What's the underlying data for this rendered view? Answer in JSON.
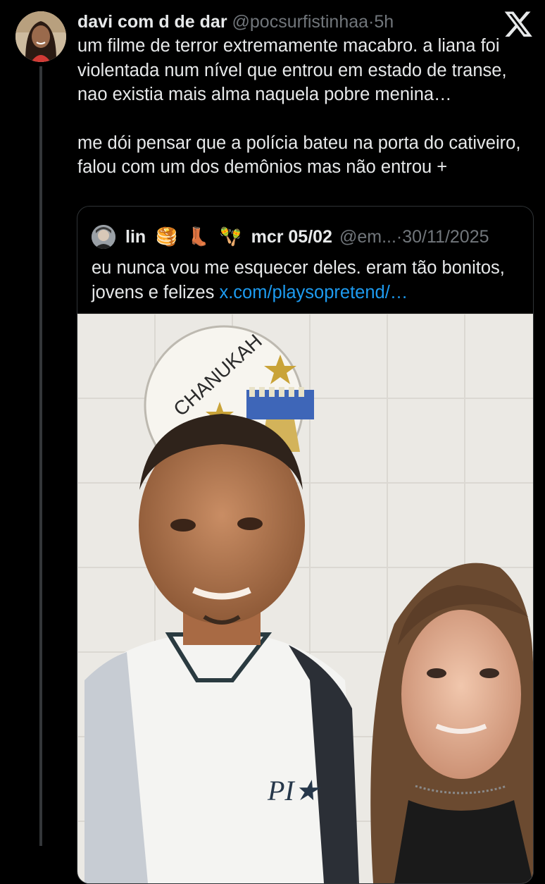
{
  "post": {
    "author_name": "davi com d de dar",
    "handle": "@pocsurfistinhaa",
    "separator": "·",
    "time": "5h",
    "paragraph1": "um filme de terror extremamente macabro. a liana foi violentada num nível que entrou em estado de transe, nao existia mais alma naquela pobre menina…",
    "paragraph2": "me dói pensar que a polícia bateu na porta do cativeiro, falou com um dos demônios mas não entrou +",
    "logo_icon": "x-logo-icon"
  },
  "quote": {
    "author_name": "lin",
    "emojis": [
      "🥞",
      "👢",
      "🪇"
    ],
    "name_suffix": "mcr 05/02",
    "handle": "@em...",
    "separator": "·",
    "date": "30/11/2025",
    "text": "eu nunca vou me esquecer deles. eram tão bonitos, jovens e felizes",
    "link": "x.com/playsopretend/…",
    "photo_sign_text": "CHANUKAH",
    "shirt_text": "PI★"
  },
  "colors": {
    "background": "#000000",
    "text": "#e7e9ea",
    "muted": "#71767b",
    "link": "#1d9bf0",
    "border": "#2f3336"
  }
}
